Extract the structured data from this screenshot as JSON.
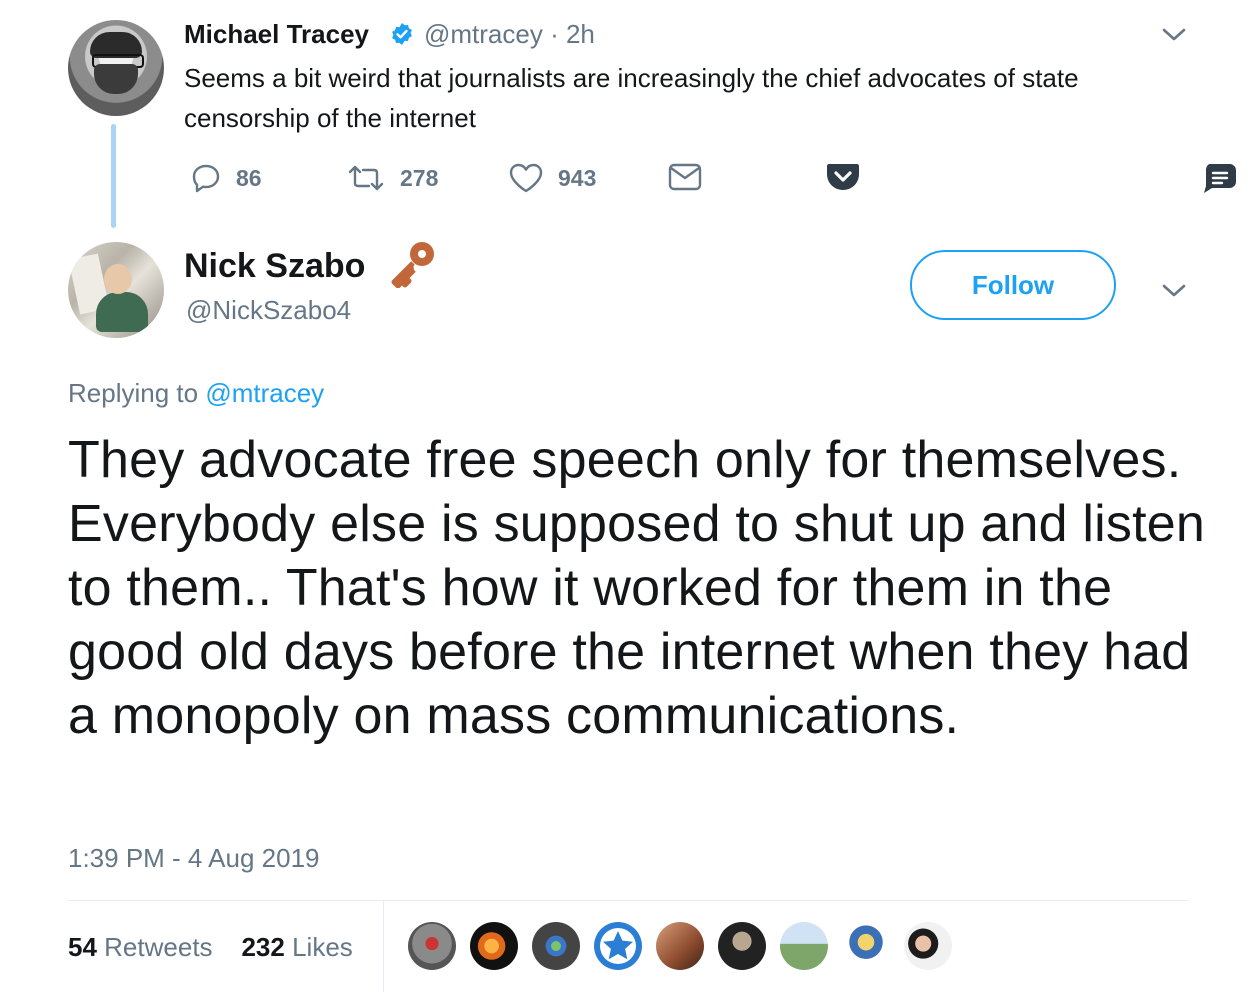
{
  "parent_tweet": {
    "author_name": "Michael Tracey",
    "handle_time": "@mtracey · 2h",
    "text": "Seems a bit weird that journalists are increasingly the chief advocates of state censorship of the internet",
    "replies": "86",
    "retweets": "278",
    "likes": "943",
    "icons": [
      "reply-icon",
      "retweet-icon",
      "like-icon",
      "dm-icon",
      "pocket-icon",
      "chevron-down-icon",
      "note-icon",
      "verified-icon"
    ]
  },
  "main_tweet": {
    "author_name": "Nick Szabo",
    "handle": "@NickSzabo4",
    "follow_label": "Follow",
    "replying_prefix": "Replying to",
    "replying_to": "@mtracey",
    "text": "They advocate free speech only for themselves.  Everybody else is supposed to shut up and listen to them..  That's how it worked for them in the good old days before the internet when they had a monopoly on mass communications.",
    "timestamp": "1:39 PM - 4 Aug 2019",
    "retweet_count": "54",
    "retweet_label": "Retweets",
    "like_count": "232",
    "like_label": "Likes",
    "icons": [
      "key-icon",
      "chevron-down-icon"
    ]
  },
  "colors": {
    "accent": "#1da1f2",
    "muted": "#657786",
    "text": "#14171a",
    "thread_line": "#a9d4f5",
    "pocket": "#ef3f56",
    "note_dark": "#2f3b46"
  }
}
